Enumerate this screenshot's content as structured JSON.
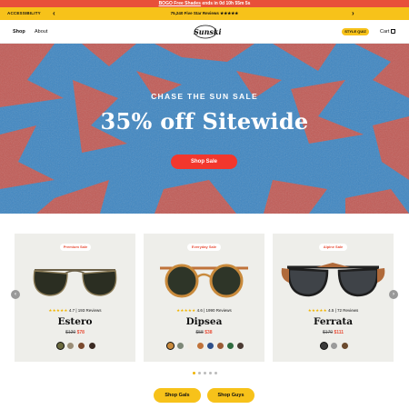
{
  "promo": {
    "highlight": "BOGO Free Shades",
    "rest": " ends in 0d 10h 55m 5s"
  },
  "subbar": {
    "accessibility": "ACCESSIBILITY",
    "prev": "‹",
    "next": "›",
    "reviews": "75,240 Five Star Reviews ★★★★★"
  },
  "nav": {
    "shop": "Shop",
    "about": "About",
    "logo": "Sunski",
    "style_quiz": "STYLE QUIZ",
    "cart": "Cart"
  },
  "hero": {
    "kicker": "CHASE THE SUN SALE",
    "headline": "35% off Sitewide",
    "cta": "Shop Sale"
  },
  "products": [
    {
      "badge": "Premium Sale",
      "stars": "★★★★★",
      "rating": "4.7 | 193 Reviews",
      "name": "Estero",
      "old_price": "$120",
      "new_price": "$78",
      "swatches": [
        "#6b6a3e",
        "#9b8e78",
        "#7a4a2e",
        "#3a2a22"
      ]
    },
    {
      "badge": "Everyday Sale",
      "stars": "★★★★★",
      "rating": "4.6 | 1990 Reviews",
      "name": "Dipsea",
      "old_price": "$58",
      "new_price": "$38",
      "swatches": [
        "#c98a3c",
        "#7d8878",
        "#f1ece4",
        "#c0733a",
        "#2d4f8a",
        "#9a5b35",
        "#2e6b3f",
        "#4a3b33"
      ]
    },
    {
      "badge": "Alpine Sale",
      "stars": "★★★★★",
      "rating": "4.5 | 72 Reviews",
      "name": "Ferrata",
      "old_price": "$170",
      "new_price": "$111",
      "swatches": [
        "#3a3a3a",
        "#9a9a9a",
        "#6b4a2e"
      ]
    }
  ],
  "carousel": {
    "prev": "‹",
    "next": "›",
    "pages": 5,
    "active": 1
  },
  "buttons": {
    "gals": "Shop Gals",
    "guys": "Shop Guys"
  },
  "colors": {
    "promo_red": "#e8503a",
    "accent_yellow": "#f7c21a",
    "cta_red": "#f2372d",
    "hero_blue": "#3e86c2",
    "hero_red": "#d0564a"
  }
}
